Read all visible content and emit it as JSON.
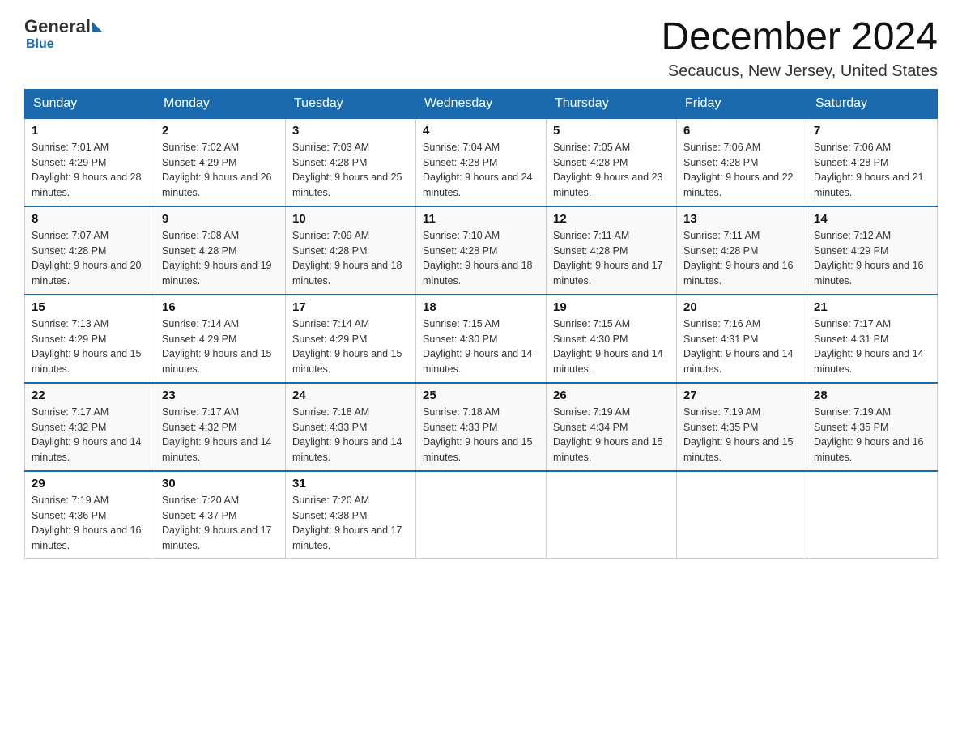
{
  "logo": {
    "text_before": "General",
    "text_after": "Blue"
  },
  "header": {
    "month_year": "December 2024",
    "location": "Secaucus, New Jersey, United States"
  },
  "weekdays": [
    "Sunday",
    "Monday",
    "Tuesday",
    "Wednesday",
    "Thursday",
    "Friday",
    "Saturday"
  ],
  "weeks": [
    [
      {
        "day": "1",
        "sunrise": "Sunrise: 7:01 AM",
        "sunset": "Sunset: 4:29 PM",
        "daylight": "Daylight: 9 hours and 28 minutes."
      },
      {
        "day": "2",
        "sunrise": "Sunrise: 7:02 AM",
        "sunset": "Sunset: 4:29 PM",
        "daylight": "Daylight: 9 hours and 26 minutes."
      },
      {
        "day": "3",
        "sunrise": "Sunrise: 7:03 AM",
        "sunset": "Sunset: 4:28 PM",
        "daylight": "Daylight: 9 hours and 25 minutes."
      },
      {
        "day": "4",
        "sunrise": "Sunrise: 7:04 AM",
        "sunset": "Sunset: 4:28 PM",
        "daylight": "Daylight: 9 hours and 24 minutes."
      },
      {
        "day": "5",
        "sunrise": "Sunrise: 7:05 AM",
        "sunset": "Sunset: 4:28 PM",
        "daylight": "Daylight: 9 hours and 23 minutes."
      },
      {
        "day": "6",
        "sunrise": "Sunrise: 7:06 AM",
        "sunset": "Sunset: 4:28 PM",
        "daylight": "Daylight: 9 hours and 22 minutes."
      },
      {
        "day": "7",
        "sunrise": "Sunrise: 7:06 AM",
        "sunset": "Sunset: 4:28 PM",
        "daylight": "Daylight: 9 hours and 21 minutes."
      }
    ],
    [
      {
        "day": "8",
        "sunrise": "Sunrise: 7:07 AM",
        "sunset": "Sunset: 4:28 PM",
        "daylight": "Daylight: 9 hours and 20 minutes."
      },
      {
        "day": "9",
        "sunrise": "Sunrise: 7:08 AM",
        "sunset": "Sunset: 4:28 PM",
        "daylight": "Daylight: 9 hours and 19 minutes."
      },
      {
        "day": "10",
        "sunrise": "Sunrise: 7:09 AM",
        "sunset": "Sunset: 4:28 PM",
        "daylight": "Daylight: 9 hours and 18 minutes."
      },
      {
        "day": "11",
        "sunrise": "Sunrise: 7:10 AM",
        "sunset": "Sunset: 4:28 PM",
        "daylight": "Daylight: 9 hours and 18 minutes."
      },
      {
        "day": "12",
        "sunrise": "Sunrise: 7:11 AM",
        "sunset": "Sunset: 4:28 PM",
        "daylight": "Daylight: 9 hours and 17 minutes."
      },
      {
        "day": "13",
        "sunrise": "Sunrise: 7:11 AM",
        "sunset": "Sunset: 4:28 PM",
        "daylight": "Daylight: 9 hours and 16 minutes."
      },
      {
        "day": "14",
        "sunrise": "Sunrise: 7:12 AM",
        "sunset": "Sunset: 4:29 PM",
        "daylight": "Daylight: 9 hours and 16 minutes."
      }
    ],
    [
      {
        "day": "15",
        "sunrise": "Sunrise: 7:13 AM",
        "sunset": "Sunset: 4:29 PM",
        "daylight": "Daylight: 9 hours and 15 minutes."
      },
      {
        "day": "16",
        "sunrise": "Sunrise: 7:14 AM",
        "sunset": "Sunset: 4:29 PM",
        "daylight": "Daylight: 9 hours and 15 minutes."
      },
      {
        "day": "17",
        "sunrise": "Sunrise: 7:14 AM",
        "sunset": "Sunset: 4:29 PM",
        "daylight": "Daylight: 9 hours and 15 minutes."
      },
      {
        "day": "18",
        "sunrise": "Sunrise: 7:15 AM",
        "sunset": "Sunset: 4:30 PM",
        "daylight": "Daylight: 9 hours and 14 minutes."
      },
      {
        "day": "19",
        "sunrise": "Sunrise: 7:15 AM",
        "sunset": "Sunset: 4:30 PM",
        "daylight": "Daylight: 9 hours and 14 minutes."
      },
      {
        "day": "20",
        "sunrise": "Sunrise: 7:16 AM",
        "sunset": "Sunset: 4:31 PM",
        "daylight": "Daylight: 9 hours and 14 minutes."
      },
      {
        "day": "21",
        "sunrise": "Sunrise: 7:17 AM",
        "sunset": "Sunset: 4:31 PM",
        "daylight": "Daylight: 9 hours and 14 minutes."
      }
    ],
    [
      {
        "day": "22",
        "sunrise": "Sunrise: 7:17 AM",
        "sunset": "Sunset: 4:32 PM",
        "daylight": "Daylight: 9 hours and 14 minutes."
      },
      {
        "day": "23",
        "sunrise": "Sunrise: 7:17 AM",
        "sunset": "Sunset: 4:32 PM",
        "daylight": "Daylight: 9 hours and 14 minutes."
      },
      {
        "day": "24",
        "sunrise": "Sunrise: 7:18 AM",
        "sunset": "Sunset: 4:33 PM",
        "daylight": "Daylight: 9 hours and 14 minutes."
      },
      {
        "day": "25",
        "sunrise": "Sunrise: 7:18 AM",
        "sunset": "Sunset: 4:33 PM",
        "daylight": "Daylight: 9 hours and 15 minutes."
      },
      {
        "day": "26",
        "sunrise": "Sunrise: 7:19 AM",
        "sunset": "Sunset: 4:34 PM",
        "daylight": "Daylight: 9 hours and 15 minutes."
      },
      {
        "day": "27",
        "sunrise": "Sunrise: 7:19 AM",
        "sunset": "Sunset: 4:35 PM",
        "daylight": "Daylight: 9 hours and 15 minutes."
      },
      {
        "day": "28",
        "sunrise": "Sunrise: 7:19 AM",
        "sunset": "Sunset: 4:35 PM",
        "daylight": "Daylight: 9 hours and 16 minutes."
      }
    ],
    [
      {
        "day": "29",
        "sunrise": "Sunrise: 7:19 AM",
        "sunset": "Sunset: 4:36 PM",
        "daylight": "Daylight: 9 hours and 16 minutes."
      },
      {
        "day": "30",
        "sunrise": "Sunrise: 7:20 AM",
        "sunset": "Sunset: 4:37 PM",
        "daylight": "Daylight: 9 hours and 17 minutes."
      },
      {
        "day": "31",
        "sunrise": "Sunrise: 7:20 AM",
        "sunset": "Sunset: 4:38 PM",
        "daylight": "Daylight: 9 hours and 17 minutes."
      },
      null,
      null,
      null,
      null
    ]
  ]
}
